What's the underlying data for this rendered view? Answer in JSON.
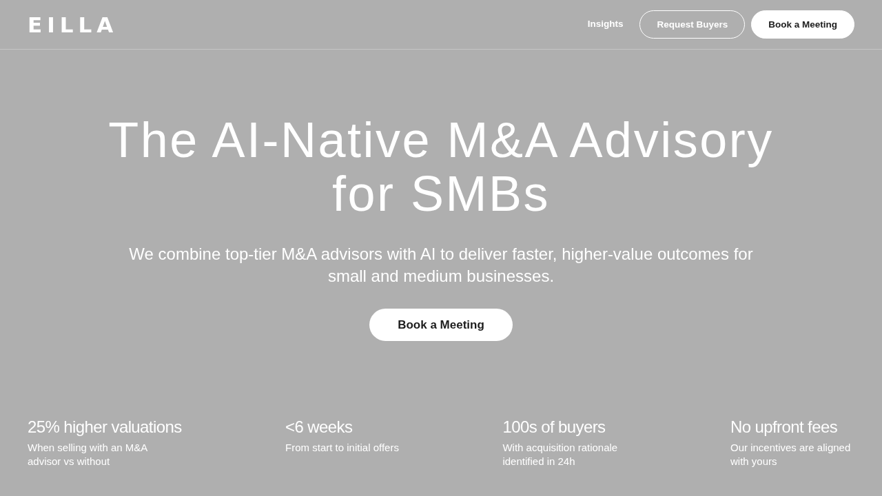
{
  "navbar": {
    "logo": "EILLA",
    "links": [
      {
        "label": "Insights",
        "kind": "link"
      },
      {
        "label": "Request Buyers",
        "kind": "outline"
      },
      {
        "label": "Book a Meeting",
        "kind": "solid"
      }
    ]
  },
  "hero": {
    "title": "The AI-Native M&A Advisory for SMBs",
    "subtitle": "We combine top-tier M&A advisors with AI to deliver faster, higher-value outcomes for small and medium businesses.",
    "button": "Book a Meeting"
  },
  "stats": [
    {
      "value": "25% higher valuations",
      "description": "When selling with an M&A advisor vs without"
    },
    {
      "value": "<6 weeks",
      "description": "From start to initial offers"
    },
    {
      "value": "100s of buyers",
      "description": "With acquisition rationale identified in 24h"
    },
    {
      "value": "No upfront fees",
      "description": "Our incentives are aligned with yours"
    }
  ]
}
